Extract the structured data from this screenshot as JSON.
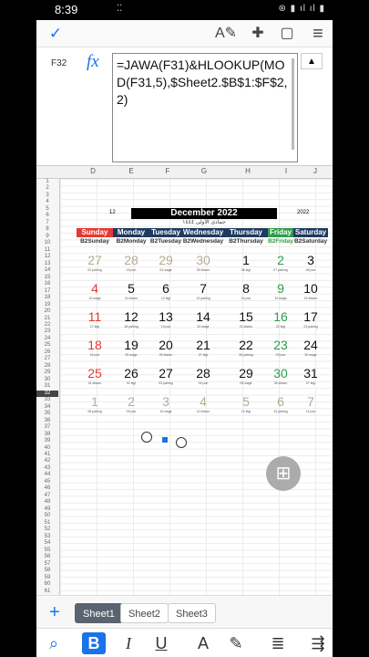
{
  "status": {
    "time": "8:39",
    "left_icons": "⁚⁚",
    "right_icons": "⊛ ▮ ıl ıl ▮"
  },
  "toolbar": {
    "check_icon": "check-icon",
    "check": "✓",
    "pen_icon": "pen-icon",
    "pen": "A✎",
    "shapes_icon": "shapes-icon",
    "shapes": "✚",
    "comment_icon": "comment-icon",
    "comment": "▢",
    "menu_icon": "menu-icon",
    "menu": "≡"
  },
  "formula_bar": {
    "cell_ref": "F32",
    "fx": "fx",
    "formula": "=JAWA(F31)&HLOOKUP(MOD(F31,5),$Sheet2.$B$1:$F$2,2)",
    "up_arrow": "▲"
  },
  "columns": [
    "D",
    "E",
    "F",
    "G",
    "H",
    "I",
    "J"
  ],
  "rows": [
    "1",
    "2",
    "3",
    "4",
    "5",
    "6",
    "7",
    "8",
    "9",
    "10",
    "11",
    "12",
    "13",
    "14",
    "15",
    "16",
    "17",
    "18",
    "19",
    "20",
    "21",
    "22",
    "23",
    "24",
    "25",
    "26",
    "27",
    "28",
    "29",
    "30",
    "31",
    "32",
    "33",
    "34",
    "35",
    "36",
    "37",
    "38",
    "39",
    "40",
    "41",
    "42",
    "43",
    "44",
    "45",
    "46",
    "47",
    "48",
    "49",
    "50",
    "51",
    "52",
    "53",
    "54",
    "55",
    "56",
    "57",
    "58",
    "59",
    "60",
    "61"
  ],
  "selected_row": "32",
  "calendar": {
    "title": "December 2022",
    "left_year": "12",
    "right_year": "2022",
    "subtitle": "جمادى الأولى ١٤٤٤",
    "days": [
      {
        "name": "Sunday",
        "sub": "B2Sunday",
        "color": "#e53935"
      },
      {
        "name": "Monday",
        "sub": "B2Monday",
        "color": "#1f3a5f"
      },
      {
        "name": "Tuesday",
        "sub": "B2Tuesday",
        "color": "#1f3a5f"
      },
      {
        "name": "Wednesday",
        "sub": "B2Wednesday",
        "color": "#1f3a5f"
      },
      {
        "name": "Thursday",
        "sub": "B2Thursday",
        "color": "#1f3a5f"
      },
      {
        "name": "Friday",
        "sub": "B2Friday",
        "color": "#2e9e48"
      },
      {
        "name": "Saturday",
        "sub": "B2Saturday",
        "color": "#1f3a5f"
      }
    ],
    "weeks": [
      [
        {
          "n": "27",
          "p": "02 pahing",
          "c": "#b3ab93"
        },
        {
          "n": "28",
          "p": "03 pon",
          "c": "#b3ab93"
        },
        {
          "n": "29",
          "p": "04 wage",
          "c": "#b3ab93"
        },
        {
          "n": "30",
          "p": "05 kliwon",
          "c": "#b3ab93"
        },
        {
          "n": "1",
          "p": "06 legi",
          "c": "#111111"
        },
        {
          "n": "2",
          "p": "07 pahing",
          "c": "#2e9e48"
        },
        {
          "n": "3",
          "p": "08 pon",
          "c": "#111111"
        }
      ],
      [
        {
          "n": "4",
          "p": "10 wage",
          "c": "#e53935"
        },
        {
          "n": "5",
          "p": "11 kliwon",
          "c": "#111111"
        },
        {
          "n": "6",
          "p": "12 legi",
          "c": "#111111"
        },
        {
          "n": "7",
          "p": "13 pahing",
          "c": "#111111"
        },
        {
          "n": "8",
          "p": "14 pon",
          "c": "#111111"
        },
        {
          "n": "9",
          "p": "15 wage",
          "c": "#2e9e48"
        },
        {
          "n": "10",
          "p": "16 kliwon",
          "c": "#111111"
        }
      ],
      [
        {
          "n": "11",
          "p": "17 legi",
          "c": "#e53935"
        },
        {
          "n": "12",
          "p": "18 pahing",
          "c": "#111111"
        },
        {
          "n": "13",
          "p": "19 pon",
          "c": "#111111"
        },
        {
          "n": "14",
          "p": "20 wage",
          "c": "#111111"
        },
        {
          "n": "15",
          "p": "21 kliwon",
          "c": "#111111"
        },
        {
          "n": "16",
          "p": "22 legi",
          "c": "#2e9e48"
        },
        {
          "n": "17",
          "p": "23 pahing",
          "c": "#111111"
        }
      ],
      [
        {
          "n": "18",
          "p": "24 pon",
          "c": "#e53935"
        },
        {
          "n": "19",
          "p": "25 wage",
          "c": "#111111"
        },
        {
          "n": "20",
          "p": "26 kliwon",
          "c": "#111111"
        },
        {
          "n": "21",
          "p": "27 legi",
          "c": "#111111"
        },
        {
          "n": "22",
          "p": "28 pahing",
          "c": "#111111"
        },
        {
          "n": "23",
          "p": "29 pon",
          "c": "#2e9e48"
        },
        {
          "n": "24",
          "p": "30 wage",
          "c": "#111111"
        }
      ],
      [
        {
          "n": "25",
          "p": "01 kliwon",
          "c": "#e53935"
        },
        {
          "n": "26",
          "p": "02 legi",
          "c": "#111111"
        },
        {
          "n": "27",
          "p": "03 pahing",
          "c": "#111111"
        },
        {
          "n": "28",
          "p": "04 pon",
          "c": "#111111"
        },
        {
          "n": "29",
          "p": "05 wage",
          "c": "#111111"
        },
        {
          "n": "30",
          "p": "06 kliwon",
          "c": "#2e9e48"
        },
        {
          "n": "31",
          "p": "07 legi",
          "c": "#111111"
        }
      ],
      [
        {
          "n": "1",
          "p": "08 pahing",
          "c": "#b3ab93"
        },
        {
          "n": "2",
          "p": "09 pon",
          "c": "#b3ab93"
        },
        {
          "n": "3",
          "p": "10 wage",
          "c": "#b3ab93"
        },
        {
          "n": "4",
          "p": "11 kliwon",
          "c": "#b3ab93"
        },
        {
          "n": "5",
          "p": "12 legi",
          "c": "#b3ab93"
        },
        {
          "n": "6",
          "p": "13 pahing",
          "c": "#b3ab93"
        },
        {
          "n": "7",
          "p": "14 pon",
          "c": "#b3ab93"
        }
      ]
    ]
  },
  "float_button": {
    "icon": "grid-icon",
    "glyph": "⊞"
  },
  "sheets": {
    "add": "+",
    "tabs": [
      "Sheet1",
      "Sheet2",
      "Sheet3"
    ]
  },
  "format_bar": {
    "search": "⌕",
    "bold": "B",
    "italic": "I",
    "underline": "U",
    "font_color": "A",
    "highlight": "✎",
    "align": "≣",
    "wrap": "⇶"
  }
}
